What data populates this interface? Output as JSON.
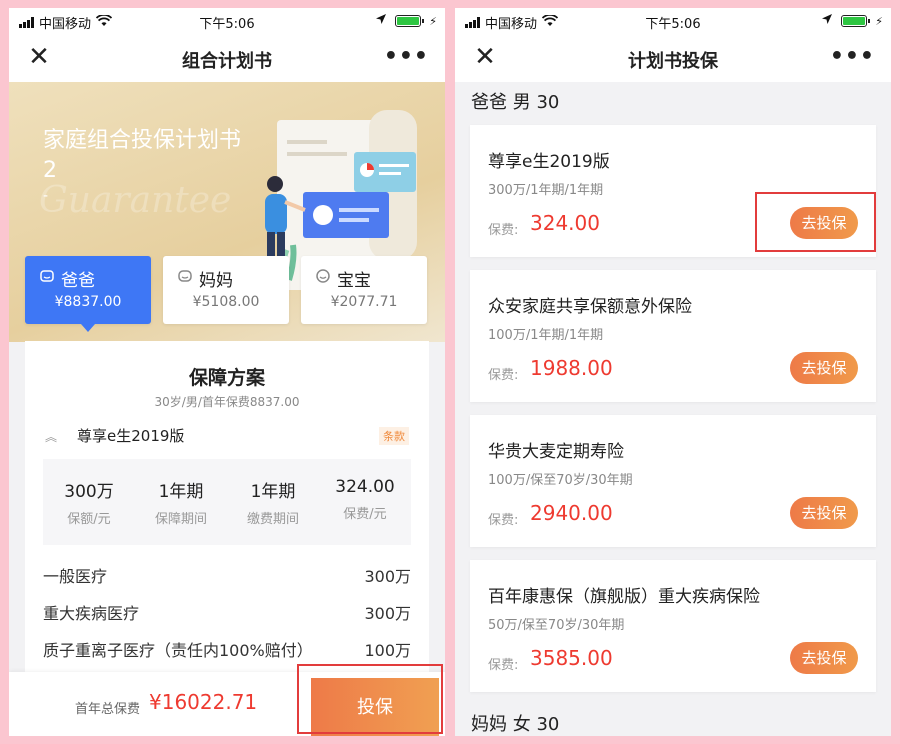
{
  "status": {
    "carrier": "中国移动",
    "time": "下午5:06"
  },
  "left": {
    "nav_title": "组合计划书",
    "hero": {
      "title": "家庭组合投保计划书2",
      "dash": "-",
      "watermark": "Guarantee"
    },
    "tabs": [
      {
        "label": "爸爸",
        "amount": "¥8837.00",
        "icon": "father-icon"
      },
      {
        "label": "妈妈",
        "amount": "¥5108.00",
        "icon": "mother-icon"
      },
      {
        "label": "宝宝",
        "amount": "¥2077.71",
        "icon": "baby-icon"
      }
    ],
    "plan": {
      "title": "保障方案",
      "subtitle": "30岁/男/首年保费8837.00",
      "product_name": "尊享e生2019版",
      "terms_label": "条款",
      "stats": [
        {
          "value": "300万",
          "label": "保额/元"
        },
        {
          "value": "1年期",
          "label": "保障期间"
        },
        {
          "value": "1年期",
          "label": "缴费期间"
        },
        {
          "value": "324.00",
          "label": "保费/元"
        }
      ],
      "coverage": [
        {
          "name": "一般医疗",
          "value": "300万"
        },
        {
          "name": "重大疾病医疗",
          "value": "300万"
        },
        {
          "name": "质子重离子医疗（责任内100%赔付）",
          "value": "100万"
        }
      ]
    },
    "footer": {
      "total_label": "首年总保费",
      "total_value": "¥16022.71",
      "buy_label": "投保"
    }
  },
  "right": {
    "nav_title": "计划书投保",
    "section_top": "爸爸 男 30",
    "section_bottom": "妈妈 女 30",
    "fee_label": "保费:",
    "go_label": "去投保",
    "products": [
      {
        "name": "尊享e生2019版",
        "desc": "300万/1年期/1年期",
        "price": "324.00"
      },
      {
        "name": "众安家庭共享保额意外保险",
        "desc": "100万/1年期/1年期",
        "price": "1988.00"
      },
      {
        "name": "华贵大麦定期寿险",
        "desc": "100万/保至70岁/30年期",
        "price": "2940.00"
      },
      {
        "name": "百年康惠保（旗舰版）重大疾病保险",
        "desc": "50万/保至70岁/30年期",
        "price": "3585.00"
      }
    ]
  },
  "colors": {
    "accent_blue": "#3e77f5",
    "price_red": "#ee3a30",
    "cta_orange": "#ee7a48",
    "highlight_red": "#e23c3c"
  }
}
